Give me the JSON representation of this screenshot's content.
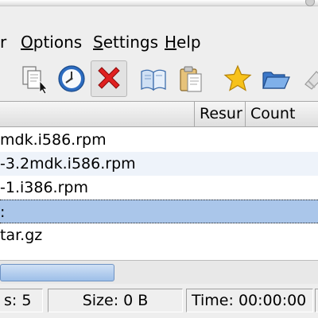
{
  "menubar": {
    "items": [
      {
        "label": "r"
      },
      {
        "label": "Options",
        "mnemonic": "O",
        "rest": "ptions"
      },
      {
        "label": "Settings",
        "mnemonic": "S",
        "rest": "ettings"
      },
      {
        "label": "Help",
        "mnemonic": "H",
        "rest": "elp"
      }
    ]
  },
  "toolbar": {
    "buttons": [
      {
        "icon": "copy-cursor-icon"
      },
      {
        "icon": "clock-icon"
      },
      {
        "icon": "delete-x-icon"
      },
      {
        "icon": "book-icon"
      },
      {
        "icon": "clipboard-icon"
      },
      {
        "icon": "star-icon"
      },
      {
        "icon": "open-folder-icon"
      },
      {
        "icon": "partial-icon"
      }
    ]
  },
  "list": {
    "columns": [
      {
        "label": ""
      },
      {
        "label": "Resur"
      },
      {
        "label": "Count"
      }
    ],
    "rows": [
      {
        "name": "mdk.i586.rpm"
      },
      {
        "name": "-3.2mdk.i586.rpm"
      },
      {
        "name": "-1.i386.rpm"
      },
      {
        "name": ":"
      },
      {
        "name": "tar.gz"
      }
    ],
    "scroll_position": 0.0
  },
  "statusbar": {
    "files": "s: 5",
    "size": "Size: 0 B",
    "time": "Time: 00:00:00"
  },
  "colors": {
    "selection": "#aac6ea",
    "alt_row": "#eef3fa",
    "scroll_thumb": "#9dbfe8"
  }
}
